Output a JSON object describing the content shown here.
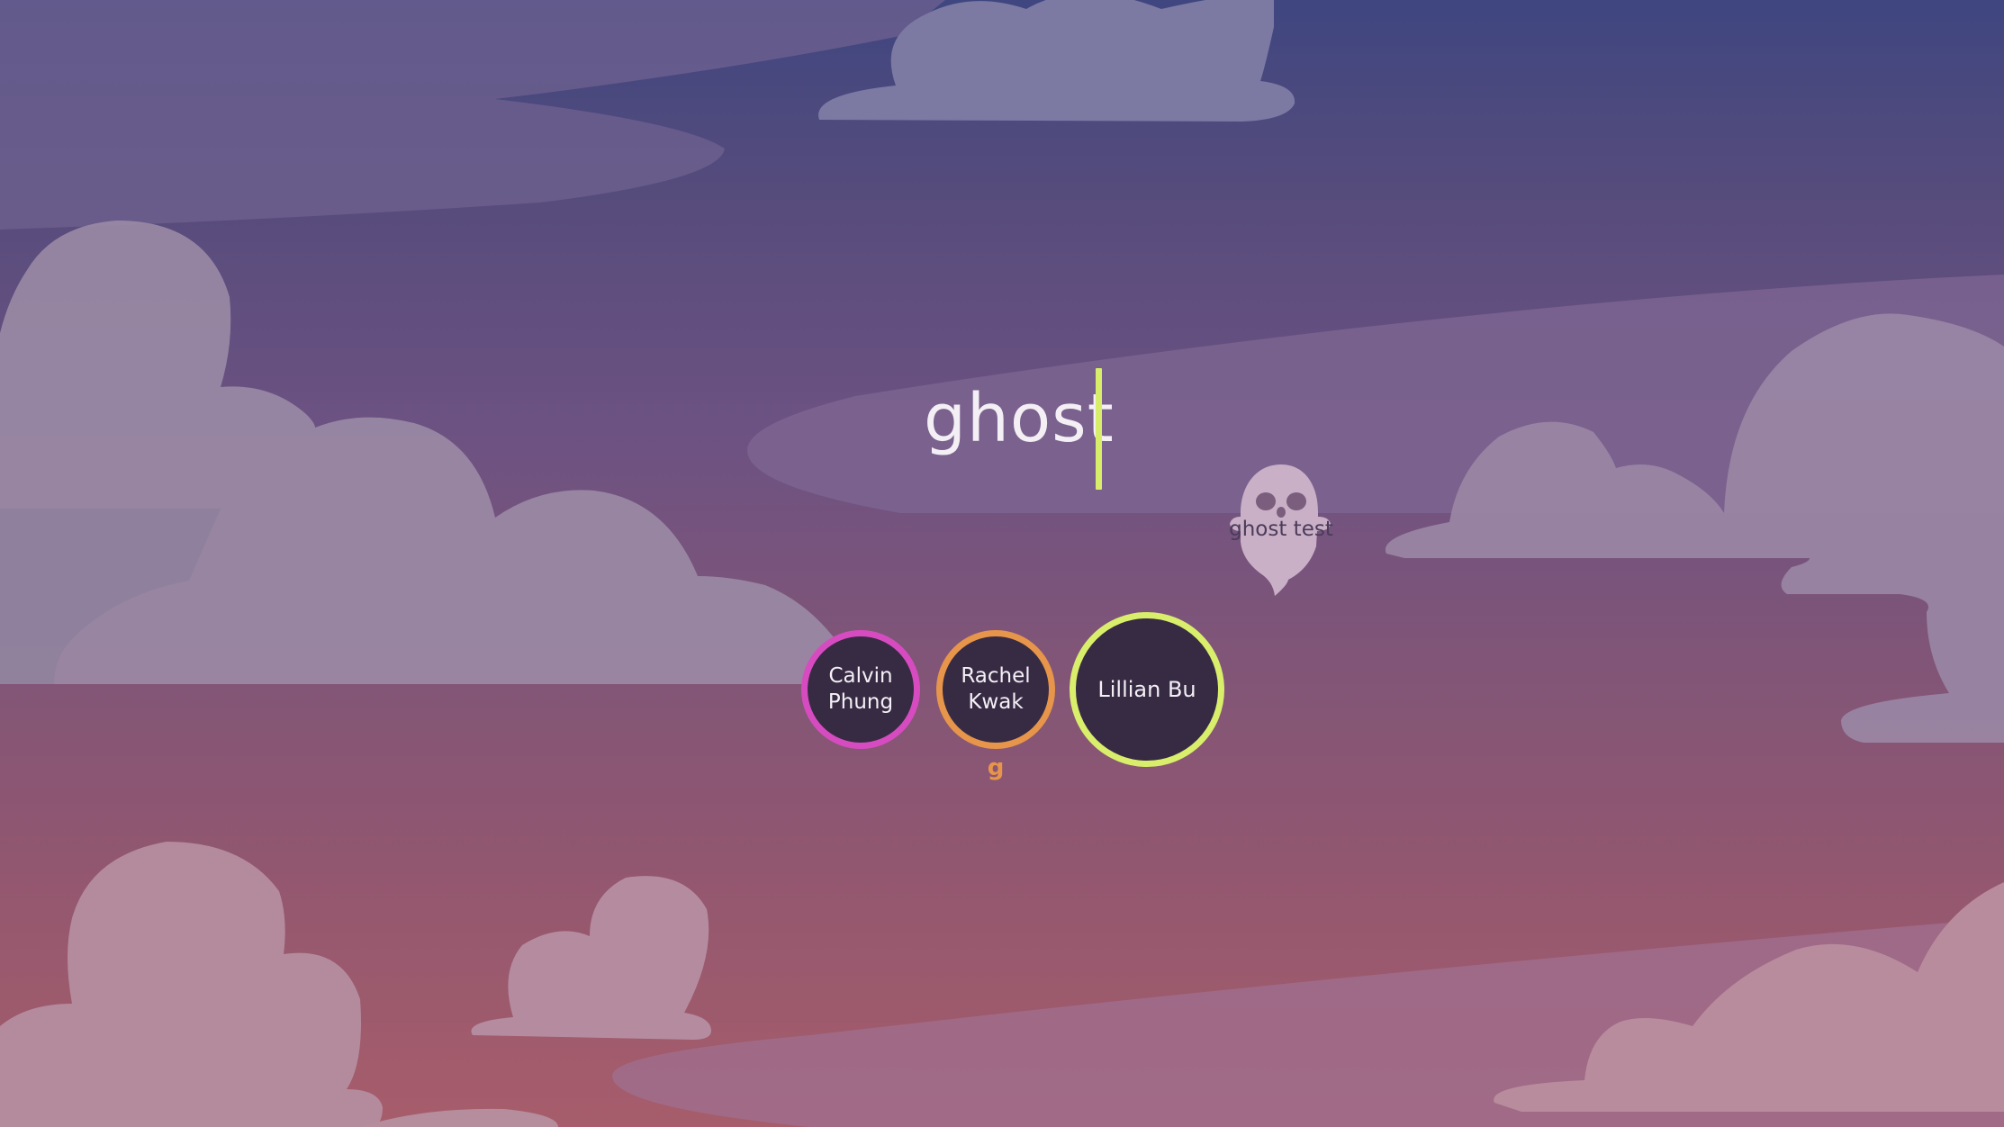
{
  "game": {
    "typed_word": "ghost",
    "ghost_player_label": "ghost test"
  },
  "players": [
    {
      "name": "Calvin Phung",
      "ring_color": "#d64cc0",
      "current_input": ""
    },
    {
      "name": "Rachel Kwak",
      "ring_color": "#e7954a",
      "current_input": "g"
    },
    {
      "name": "Lillian Bu",
      "ring_color": "#d9ef6b",
      "current_input": "",
      "active": true
    }
  ],
  "colors": {
    "caret": "#d8ee6a",
    "player_fill": "#372b44"
  },
  "icons": {
    "ghost": "ghost-icon"
  }
}
